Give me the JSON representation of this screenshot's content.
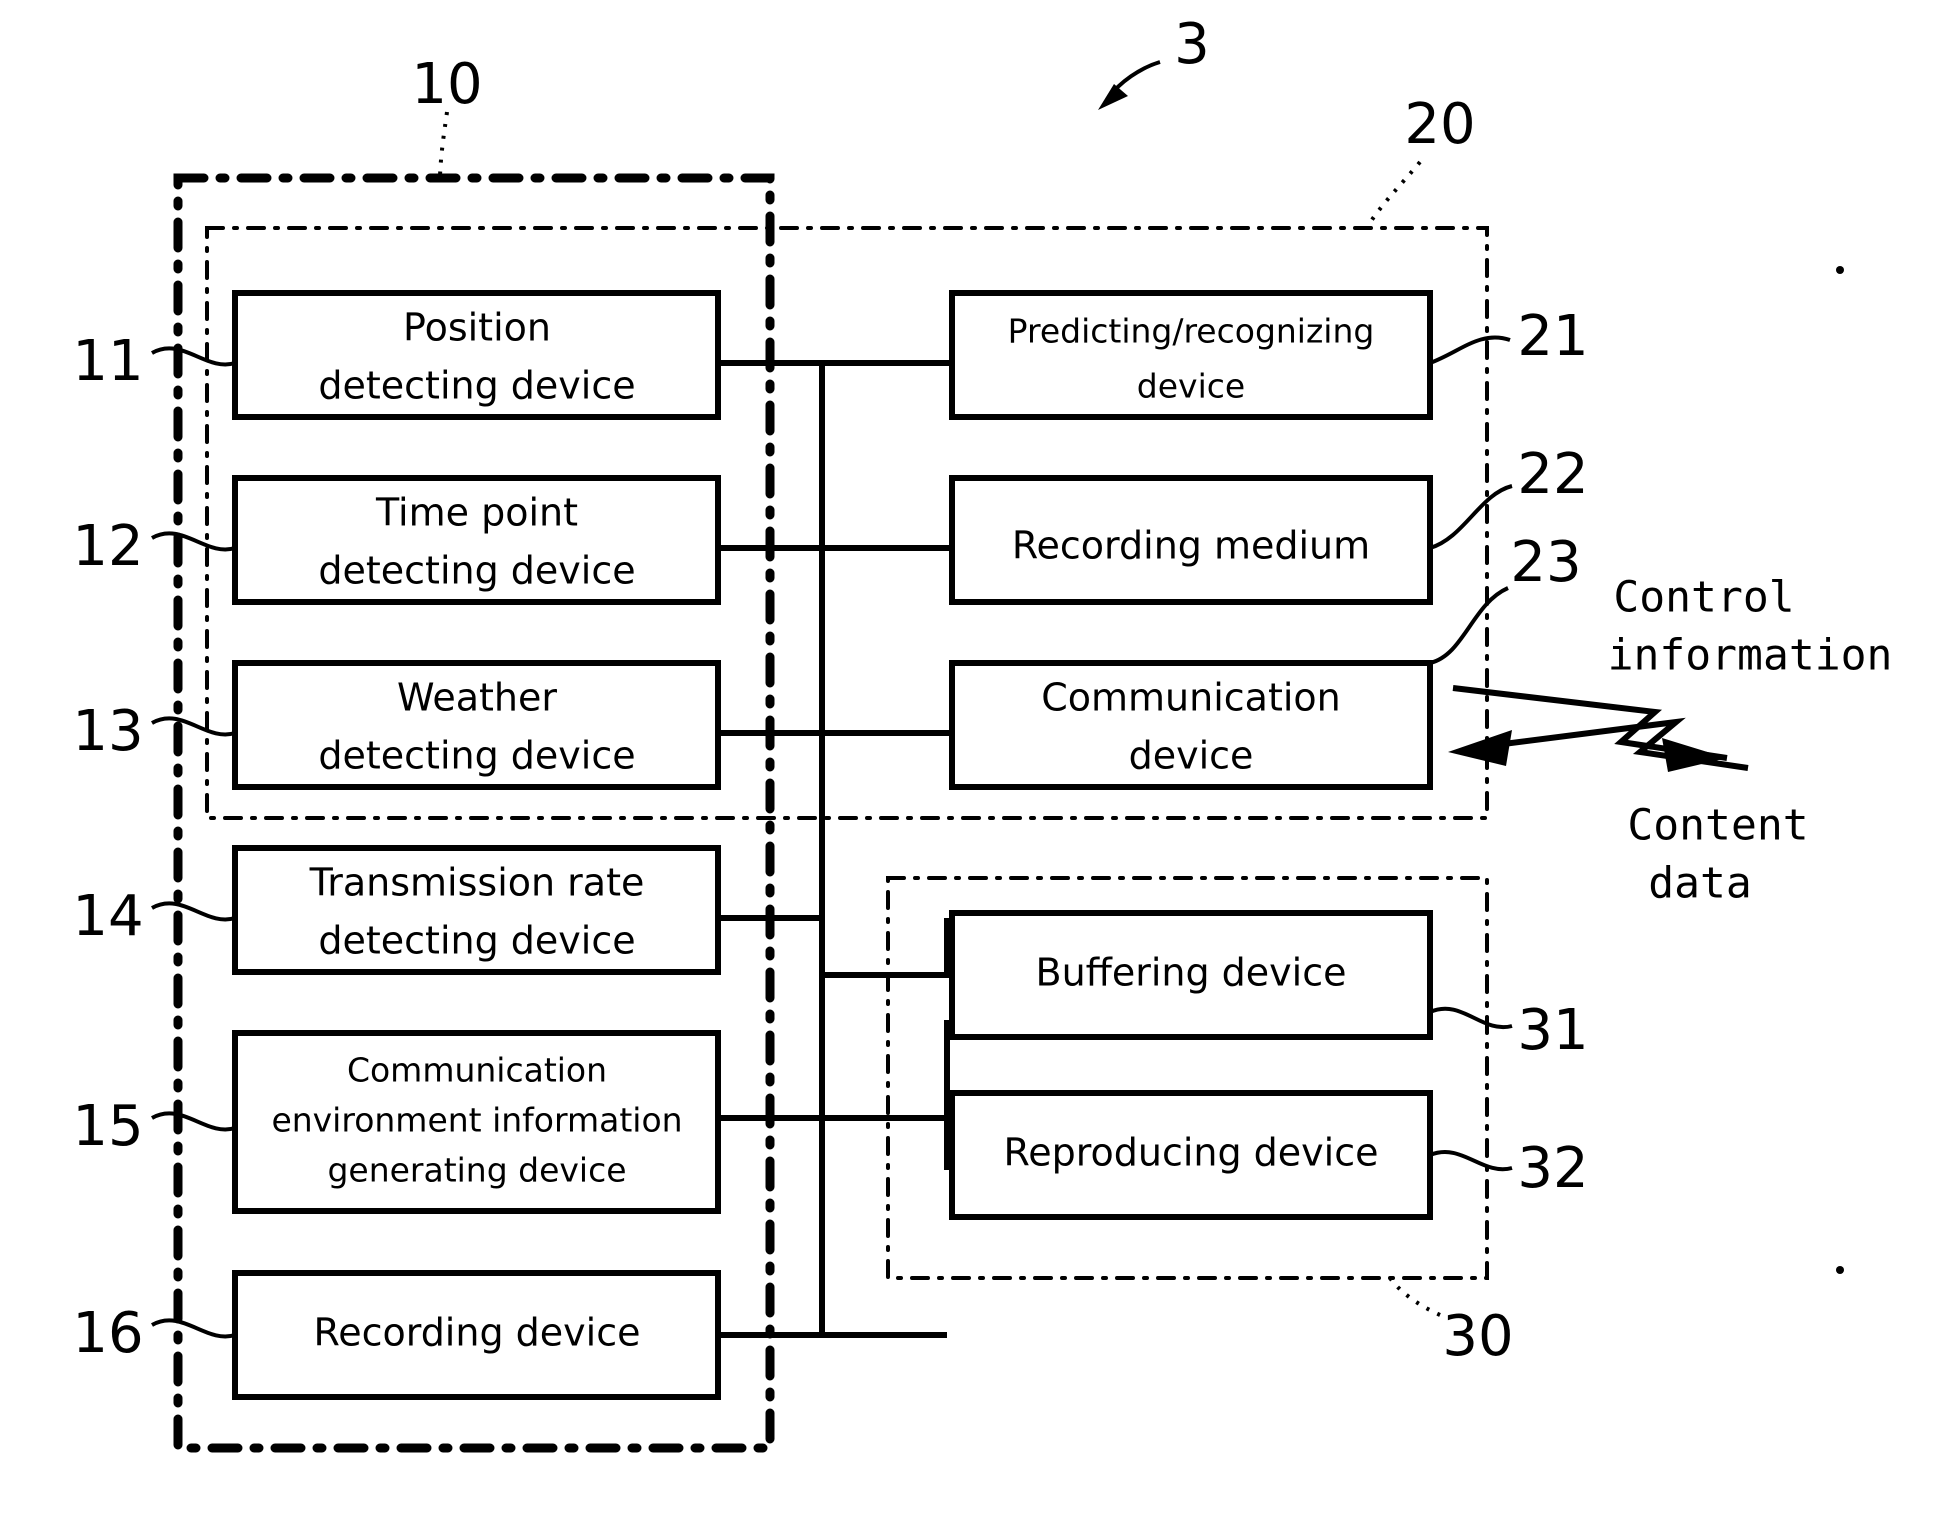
{
  "figure": {
    "system_ref": "3",
    "groups": [
      {
        "id": "g10",
        "ref": "10",
        "name": "detecting-device-group"
      },
      {
        "id": "g20",
        "ref": "20",
        "name": "processing-group"
      },
      {
        "id": "g30",
        "ref": "30",
        "name": "playback-group"
      }
    ],
    "left_blocks": [
      {
        "ref": "11",
        "lines": [
          "Position",
          "detecting device"
        ],
        "name": "position-detecting-device"
      },
      {
        "ref": "12",
        "lines": [
          "Time point",
          "detecting device"
        ],
        "name": "time-point-detecting-device"
      },
      {
        "ref": "13",
        "lines": [
          "Weather",
          "detecting device"
        ],
        "name": "weather-detecting-device"
      },
      {
        "ref": "14",
        "lines": [
          "Transmission rate",
          "detecting device"
        ],
        "name": "transmission-rate-detecting-device"
      },
      {
        "ref": "15",
        "lines": [
          "Communication",
          "environment information",
          "generating device"
        ],
        "name": "communication-environment-information-generating-device"
      },
      {
        "ref": "16",
        "lines": [
          "Recording device"
        ],
        "name": "recording-device"
      }
    ],
    "right_blocks": [
      {
        "ref": "21",
        "lines": [
          "Predicting/recognizing",
          "device"
        ],
        "name": "predicting-recognizing-device"
      },
      {
        "ref": "22",
        "lines": [
          "Recording medium"
        ],
        "name": "recording-medium"
      },
      {
        "ref": "23",
        "lines": [
          "Communication",
          "device"
        ],
        "name": "communication-device"
      },
      {
        "ref": "31",
        "lines": [
          "Buffering device"
        ],
        "name": "buffering-device"
      },
      {
        "ref": "32",
        "lines": [
          "Reproducing device"
        ],
        "name": "reproducing-device"
      }
    ],
    "io_signals": [
      {
        "label_lines": [
          "Control",
          "information"
        ],
        "direction": "out",
        "name": "control-information-signal"
      },
      {
        "label_lines": [
          "Content",
          "data"
        ],
        "direction": "in",
        "name": "content-data-signal"
      }
    ],
    "colors": {
      "line": "#000000",
      "background": "#ffffff"
    }
  }
}
